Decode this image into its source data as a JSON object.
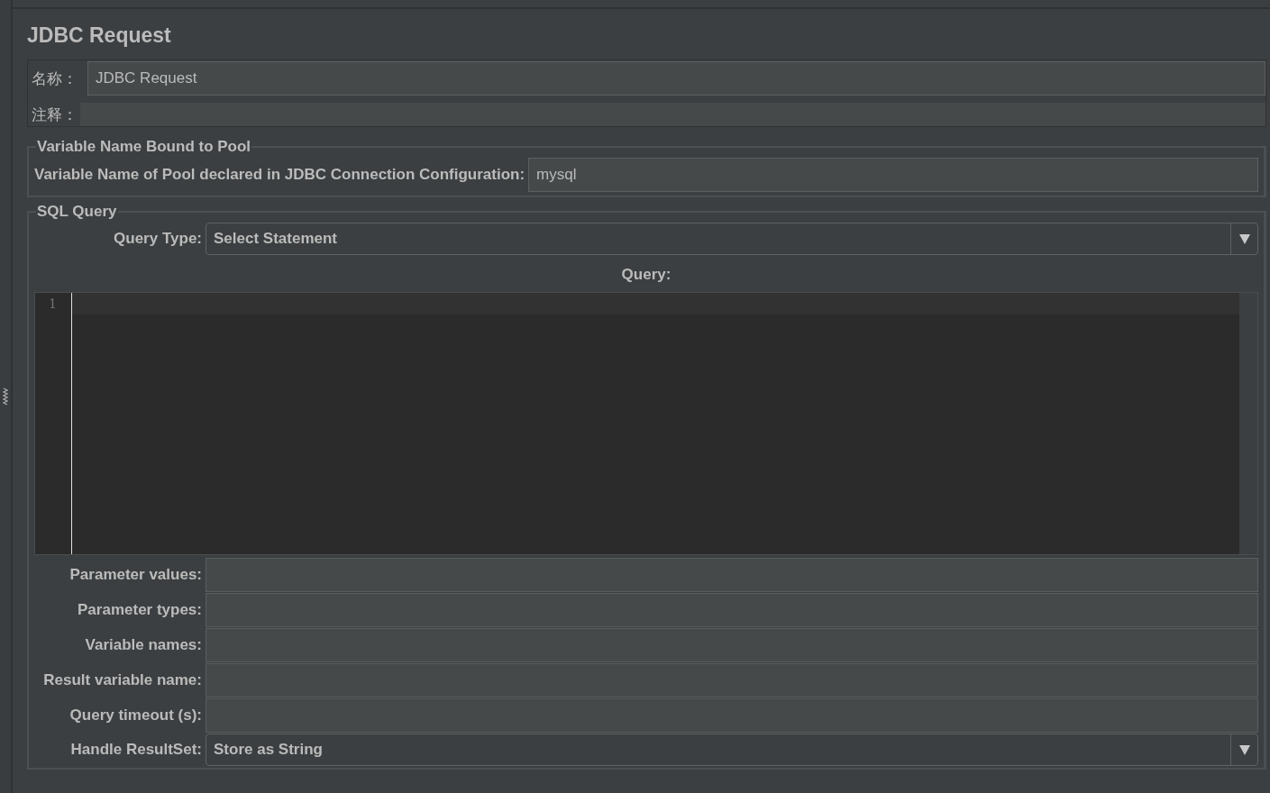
{
  "title": "JDBC Request",
  "name_field": {
    "label": "名称：",
    "value": "JDBC Request"
  },
  "comment_field": {
    "label": "注释："
  },
  "pool_section": {
    "legend": "Variable Name Bound to Pool",
    "label": "Variable Name of Pool declared in JDBC Connection Configuration:",
    "value": "mysql"
  },
  "sql_section": {
    "legend": "SQL Query",
    "query_type": {
      "label": "Query Type:",
      "value": "Select Statement"
    },
    "query_label": "Query:",
    "editor": {
      "line_numbers": [
        "1"
      ]
    },
    "fields": [
      {
        "label": "Parameter values:"
      },
      {
        "label": "Parameter types:"
      },
      {
        "label": "Variable names:"
      },
      {
        "label": "Result variable name:"
      },
      {
        "label": "Query timeout (s):"
      }
    ],
    "handle_resultset": {
      "label": "Handle ResultSet:",
      "value": "Store as String"
    }
  }
}
